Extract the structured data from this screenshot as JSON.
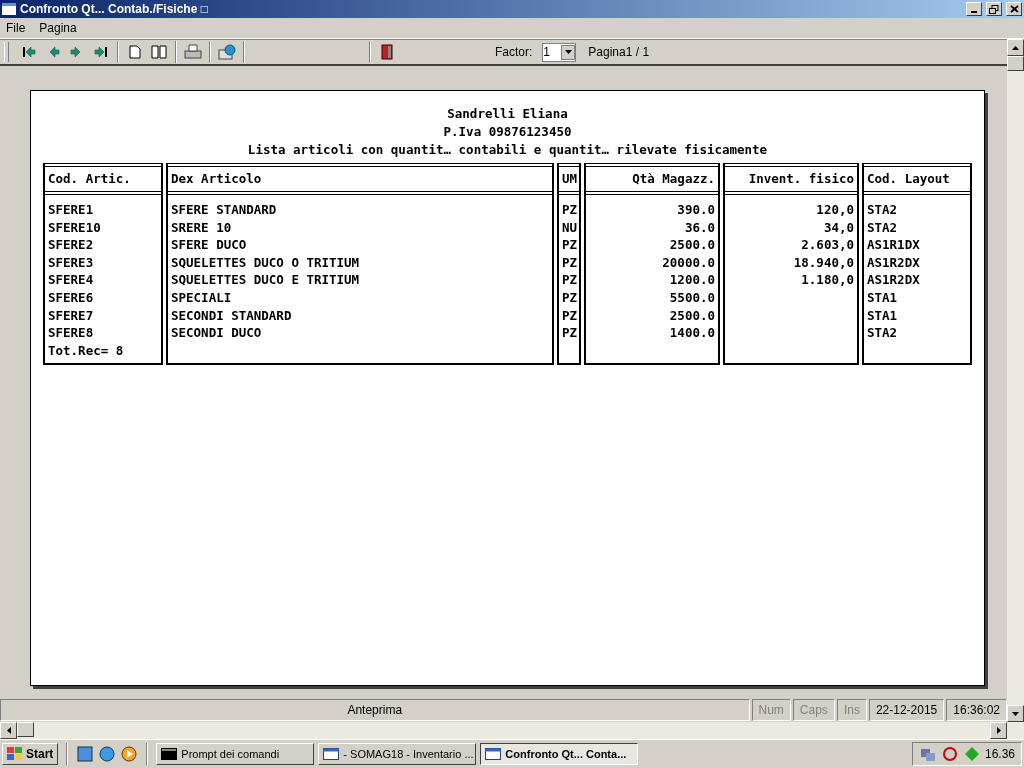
{
  "window": {
    "title": "Confronto Qt... Contab./Fisiche □"
  },
  "menu": [
    "File",
    "Pagina"
  ],
  "toolbar": {
    "factor_label": "Factor:",
    "factor_value": "1",
    "page_label": "Pagina1 / 1"
  },
  "report": {
    "header": [
      "Sandrelli Eliana",
      "P.Iva 09876123450",
      "Lista articoli con quantit… contabili e quantit… rilevate fisicamente"
    ],
    "columns": [
      {
        "label": "Cod. Artic.",
        "kind": "text"
      },
      {
        "label": "Dex Articolo",
        "kind": "text"
      },
      {
        "label": "UM",
        "kind": "text"
      },
      {
        "label": "Qtà Magazz.",
        "kind": "number"
      },
      {
        "label": "Invent. fisico",
        "kind": "number"
      },
      {
        "label": "Cod. Layout",
        "kind": "text"
      }
    ],
    "rows": [
      [
        "SFERE1",
        "SFERE STANDARD",
        "PZ",
        "390.0",
        "120,0",
        "STA2"
      ],
      [
        "SFERE10",
        "SRERE 10",
        "NU",
        "36.0",
        "34,0",
        "STA2"
      ],
      [
        "SFERE2",
        "SFERE DUCO",
        "PZ",
        "2500.0",
        "2.603,0",
        "AS1R1DX"
      ],
      [
        "SFERE3",
        "SQUELETTES DUCO O TRITIUM",
        "PZ",
        "20000.0",
        "18.940,0",
        "AS1R2DX"
      ],
      [
        "SFERE4",
        "SQUELETTES DUCO E TRITIUM",
        "PZ",
        "1200.0",
        "1.180,0",
        "AS1R2DX"
      ],
      [
        "SFERE6",
        "SPECIALI",
        "PZ",
        "5500.0",
        "",
        "STA1"
      ],
      [
        "SFERE7",
        "SECONDI STANDARD",
        "PZ",
        "2500.0",
        "",
        "STA1"
      ],
      [
        "SFERE8",
        "SECONDI DUCO",
        "PZ",
        "1400.0",
        "",
        "STA2"
      ]
    ],
    "total": "Tot.Rec= 8"
  },
  "status_bar": [
    {
      "text": "Anteprima",
      "dimmed": false
    },
    {
      "text": "Num",
      "dimmed": true
    },
    {
      "text": "Caps",
      "dimmed": true
    },
    {
      "text": "Ins",
      "dimmed": true
    },
    {
      "text": "22-12-2015",
      "dimmed": false
    },
    {
      "text": "16:36:02",
      "dimmed": false
    }
  ],
  "taskbar": {
    "start": "Start",
    "tasks": [
      {
        "label": "Prompt dei comandi",
        "kind": "console",
        "selected": false
      },
      {
        "label": "- SOMAG18 - Inventario ...",
        "kind": "window",
        "selected": false
      },
      {
        "label": "Confronto Qt... Conta...",
        "kind": "window",
        "selected": true
      }
    ],
    "clock": "16.36"
  }
}
